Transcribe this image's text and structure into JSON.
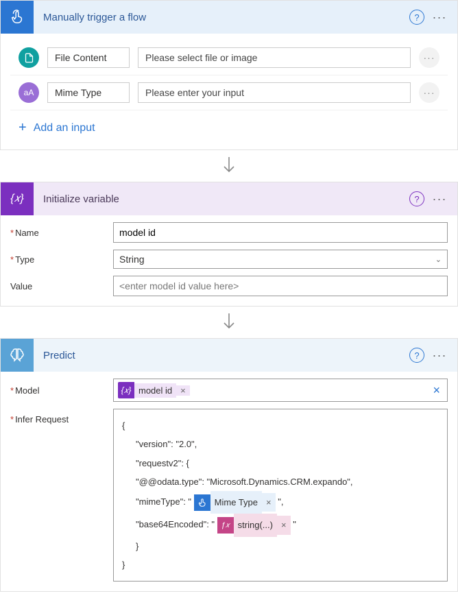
{
  "trigger": {
    "title": "Manually trigger a flow",
    "inputs": [
      {
        "label": "File Content",
        "placeholder": "Please select file or image",
        "icon": "file",
        "color": "teal"
      },
      {
        "label": "Mime Type",
        "placeholder": "Please enter your input",
        "icon": "text",
        "color": "purple"
      }
    ],
    "add_label": "Add an input"
  },
  "variable": {
    "title": "Initialize variable",
    "fields": {
      "name_label": "Name",
      "name_value": "model id",
      "type_label": "Type",
      "type_value": "String",
      "value_label": "Value",
      "value_placeholder": "<enter model id value here>"
    }
  },
  "predict": {
    "title": "Predict",
    "fields": {
      "model_label": "Model",
      "model_token": "model id",
      "infer_label": "Infer Request",
      "json": {
        "version_key": "\"version\": \"2.0\",",
        "request_key": "\"requestv2\": {",
        "odata": "\"@@odata.type\": \"Microsoft.Dynamics.CRM.expando\",",
        "mime_key": "\"mimeType\": \"",
        "mime_token": "Mime Type",
        "base64_key": "\"base64Encoded\": \"",
        "string_token": "string(...)"
      }
    }
  }
}
